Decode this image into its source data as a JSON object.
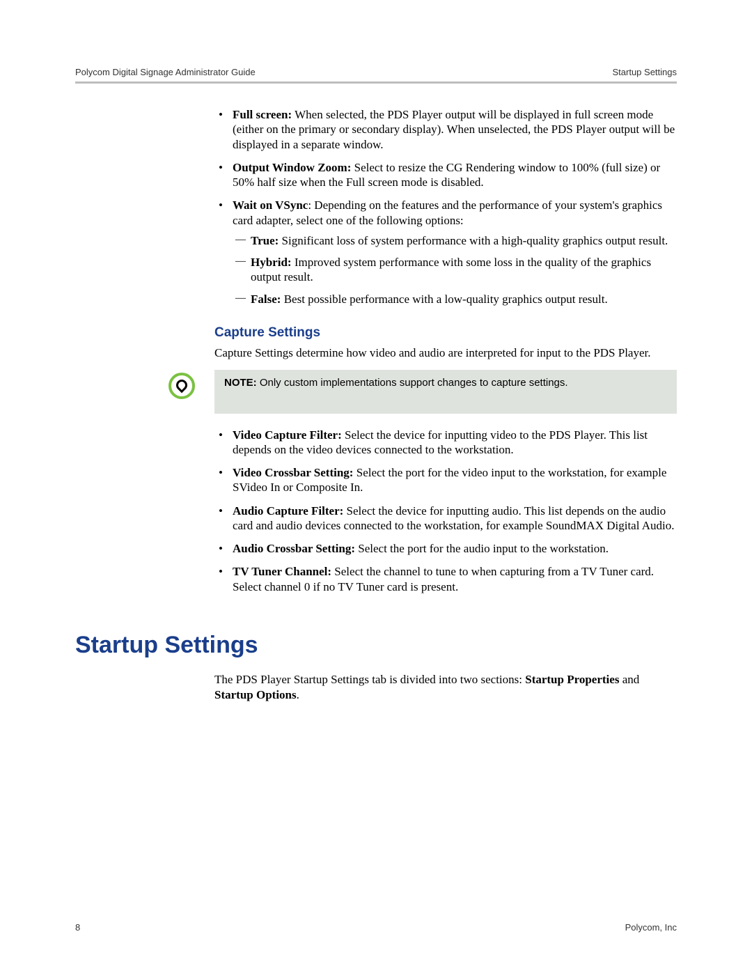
{
  "header": {
    "left": "Polycom Digital Signage Administrator Guide",
    "right": "Startup Settings"
  },
  "bullets1": {
    "fullscreen": {
      "label": "Full screen:",
      "text": " When selected, the PDS Player output will be displayed in full screen mode (either on the primary or secondary display). When unselected, the PDS Player output will be displayed in a separate window."
    },
    "zoom": {
      "label": "Output Window Zoom:",
      "text": " Select to resize the CG Rendering window to 100% (full size) or 50% half size when the Full screen mode is disabled."
    },
    "vsync": {
      "label": "Wait on VSync",
      "text": ": Depending on the features and the performance of your system's graphics card adapter, select one of the following options:",
      "sub": {
        "true": {
          "label": "True:",
          "text": " Significant loss of system performance with a high-quality graphics output result."
        },
        "hybrid": {
          "label": "Hybrid:",
          "text": " Improved system performance with some loss in the quality of the graphics output result."
        },
        "false": {
          "label": "False:",
          "text": " Best possible performance with a low-quality graphics output result."
        }
      }
    }
  },
  "capture": {
    "heading": "Capture Settings",
    "intro": "Capture Settings determine how video and audio are interpreted for input to the PDS Player.",
    "note_label": "NOTE:",
    "note_text": " Only custom implementations support changes to capture settings.",
    "items": {
      "vcf": {
        "label": "Video Capture Filter:",
        "text": " Select the device for inputting video to the PDS Player. This list depends on the video devices connected to the workstation."
      },
      "vcs": {
        "label": "Video Crossbar Setting:",
        "text": " Select the port for the video input to the workstation, for example SVideo In or Composite In."
      },
      "acf": {
        "label": "Audio Capture Filter:",
        "text": " Select the device for inputting audio. This list depends on the audio card and audio devices connected to the workstation, for example SoundMAX Digital Audio."
      },
      "acs": {
        "label": "Audio Crossbar Setting:",
        "text": " Select the port for the audio input to the workstation."
      },
      "tvt": {
        "label": "TV Tuner Channel:",
        "text": " Select the channel to tune to when capturing from a TV Tuner card. Select channel 0 if no TV Tuner card is present."
      }
    }
  },
  "startup": {
    "heading": "Startup Settings",
    "para_pre": "The PDS Player Startup Settings tab is divided into two sections: ",
    "bold1": "Startup Properties",
    "mid": " and ",
    "bold2": "Startup Options",
    "tail": "."
  },
  "footer": {
    "page": "8",
    "owner": "Polycom, Inc"
  }
}
